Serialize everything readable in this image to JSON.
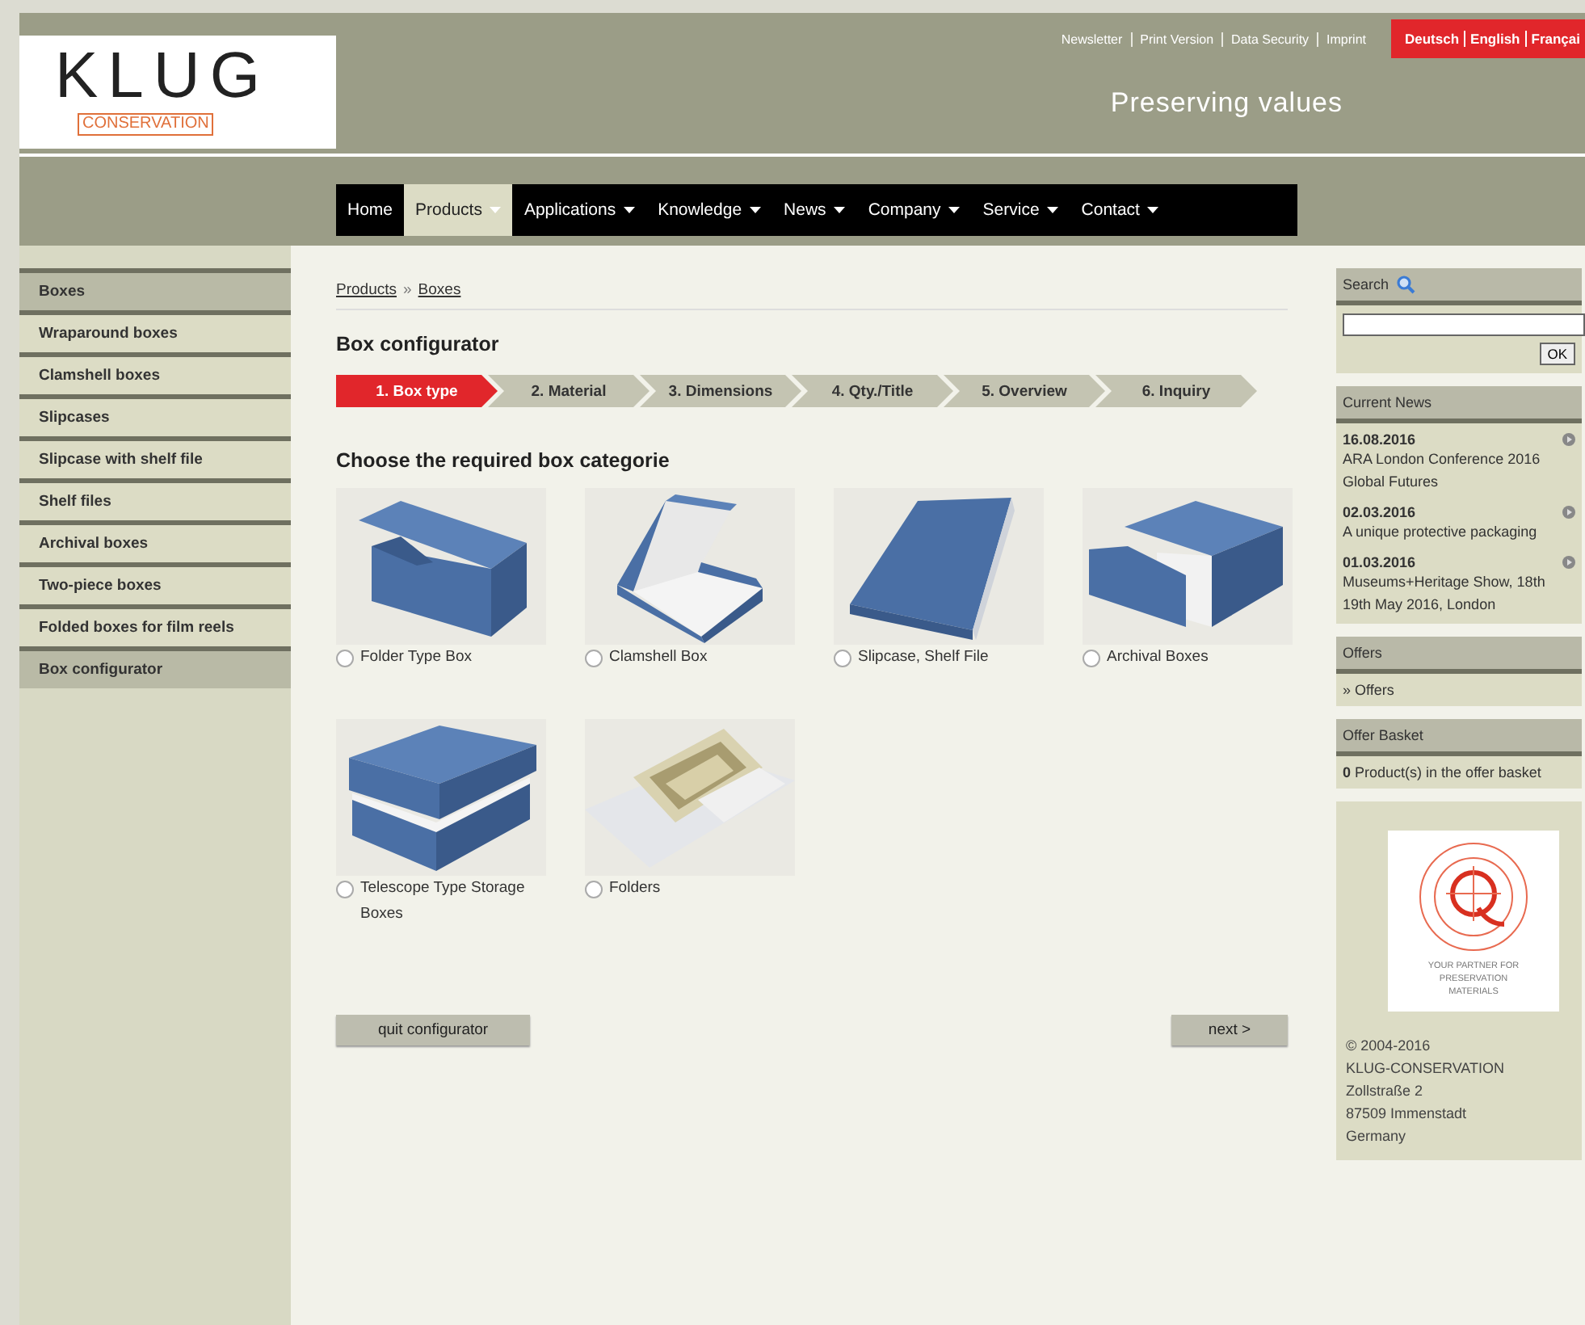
{
  "logo": {
    "main": "KLUG",
    "sub": "CONSERVATION"
  },
  "top_links": [
    "Newsletter",
    "Print Version",
    "Data Security",
    "Imprint"
  ],
  "languages": [
    "Deutsch",
    "English",
    "Françai"
  ],
  "tagline": "Preserving values",
  "nav": [
    {
      "label": "Home",
      "selected": false,
      "has_menu": false
    },
    {
      "label": "Products",
      "selected": true,
      "has_menu": true
    },
    {
      "label": "Applications",
      "selected": false,
      "has_menu": true
    },
    {
      "label": "Knowledge",
      "selected": false,
      "has_menu": true
    },
    {
      "label": "News",
      "selected": false,
      "has_menu": true
    },
    {
      "label": "Company",
      "selected": false,
      "has_menu": true
    },
    {
      "label": "Service",
      "selected": false,
      "has_menu": true
    },
    {
      "label": "Contact",
      "selected": false,
      "has_menu": true
    }
  ],
  "sidebar": {
    "items": [
      {
        "label": "Boxes",
        "selected": true
      },
      {
        "label": "Wraparound boxes",
        "selected": false
      },
      {
        "label": "Clamshell boxes",
        "selected": false
      },
      {
        "label": "Slipcases",
        "selected": false
      },
      {
        "label": "Slipcase with shelf file",
        "selected": false
      },
      {
        "label": "Shelf files",
        "selected": false
      },
      {
        "label": "Archival boxes",
        "selected": false
      },
      {
        "label": "Two-piece boxes",
        "selected": false
      },
      {
        "label": "Folded boxes for film reels",
        "selected": false
      },
      {
        "label": "Box configurator",
        "selected": true
      }
    ]
  },
  "breadcrumb": [
    "Products",
    "»",
    "Boxes"
  ],
  "title": "Box configurator",
  "steps": [
    {
      "label": "1. Box type",
      "selected": true
    },
    {
      "label": "2. Material",
      "selected": false
    },
    {
      "label": "3. Dimensions",
      "selected": false
    },
    {
      "label": "4. Qty./Title",
      "selected": false
    },
    {
      "label": "5. Overview",
      "selected": false
    },
    {
      "label": "6. Inquiry",
      "selected": false
    }
  ],
  "prompt": "Choose the required box categorie",
  "options": [
    {
      "label": "Folder Type Box",
      "kind": "folder",
      "selected": false
    },
    {
      "label": "Clamshell Box",
      "kind": "clamshell",
      "selected": false
    },
    {
      "label": "Slipcase, Shelf File",
      "kind": "slipcase",
      "selected": false
    },
    {
      "label": "Archival Boxes",
      "kind": "archival",
      "selected": false
    },
    {
      "label": "Telescope Type Storage Boxes",
      "kind": "telescope",
      "selected": false
    },
    {
      "label": "Folders",
      "kind": "folders",
      "selected": false
    }
  ],
  "buttons": {
    "quit": "quit configurator",
    "next": "next >"
  },
  "search": {
    "heading": "Search",
    "button": "OK"
  },
  "news": {
    "heading": "Current News",
    "items": [
      {
        "date": "16.08.2016",
        "text": "ARA London Conference 2016 Global Futures"
      },
      {
        "date": "02.03.2016",
        "text": "A unique protective packaging"
      },
      {
        "date": "01.03.2016",
        "text": "Museums+Heritage Show, 18th 19th May 2016, London"
      }
    ]
  },
  "offers": {
    "heading": "Offers",
    "link": "» Offers"
  },
  "basket": {
    "heading": "Offer Basket",
    "count": "0",
    "text": "Product(s) in the offer basket"
  },
  "seal": {
    "caption": "YOUR PARTNER FOR PRESERVATION MATERIALS"
  },
  "footer": [
    "© 2004-2016",
    "KLUG-CONSERVATION",
    "Zollstraße 2",
    "87509 Immenstadt",
    "Germany"
  ]
}
